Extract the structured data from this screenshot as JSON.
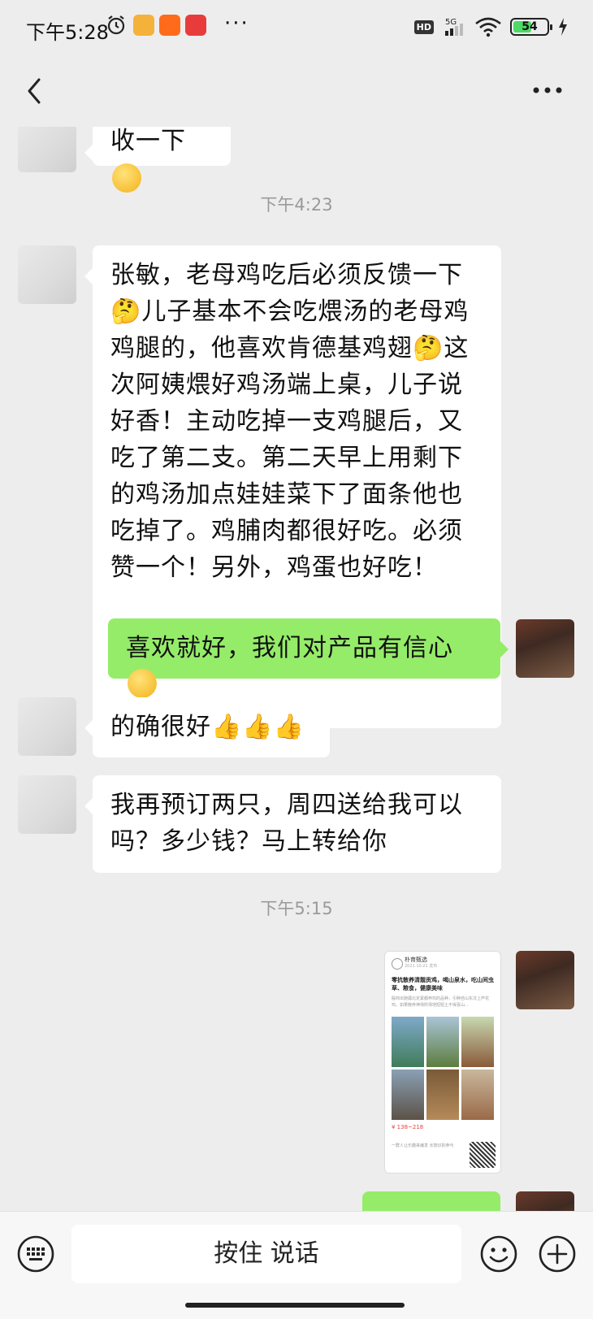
{
  "status_bar": {
    "time": "下午5:28",
    "dots": "···",
    "network": "5G",
    "hd_label": "HD",
    "battery_level": 54,
    "battery_text": "54"
  },
  "header": {
    "back_icon": "chevron-left-icon",
    "more_icon": "more-dots-icon"
  },
  "messages": {
    "m1": {
      "text": "收一下",
      "sender": "other"
    },
    "t1": "下午4:23",
    "m2": {
      "text": "张敏，老母鸡吃后必须反馈一下🤔儿子基本不会吃煨汤的老母鸡鸡腿的，他喜欢肯德基鸡翅🤔这次阿姨煨好鸡汤端上桌，儿子说好香！主动吃掉一支鸡腿后，又吃了第二支。第二天早上用剩下的鸡汤加点娃娃菜下了面条他也吃掉了。鸡脯肉都很好吃。必须赞一个！另外，鸡蛋也好吃！",
      "sender": "other"
    },
    "m3": {
      "text": "喜欢就好，我们对产品有信心",
      "sender": "me"
    },
    "m4": {
      "text": "的确很好",
      "sender": "other"
    },
    "m5": {
      "text": "我再预订两只，周四送给我可以吗？多少钱？马上转给你",
      "sender": "me_other"
    },
    "t2": "下午5:15",
    "card": {
      "account": "朴育甄选",
      "date": "2021.10.21 发布",
      "title": "零抗散养清靓贡鸡，喝山泉水，吃山间虫草、粮食，健康美味",
      "desc": "殷商出驰疆北定紧都养鸡的品种，引种自山东汶上芦花鸡，如果散养神场所场地短短土不得喜山...",
      "price": "¥ 138~218",
      "footer": "一群人让乐趣来编发 长按识别参与"
    }
  },
  "input_bar": {
    "hold_to_talk": "按住 说话",
    "keyboard_icon": "keyboard-icon",
    "emoji_icon": "smiley-icon",
    "plus_icon": "plus-circle-icon"
  },
  "colors": {
    "background": "#ededed",
    "bubble_me": "#95ec69",
    "bubble_other": "#ffffff",
    "timestamp": "#9a9a9a"
  }
}
